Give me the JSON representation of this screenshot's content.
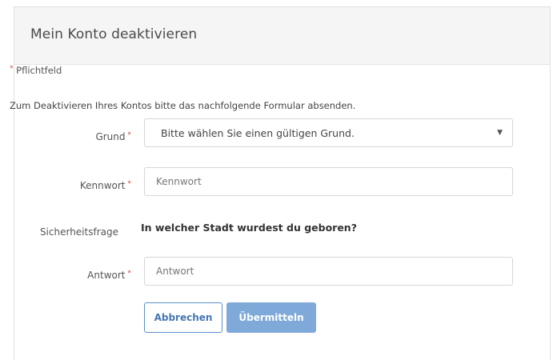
{
  "dialog": {
    "title": "Mein Konto deaktivieren",
    "required_note": "Pflichtfeld",
    "intro": "Zum Deaktivieren Ihres Kontos bitte das nachfolgende Formular absenden."
  },
  "form": {
    "reason": {
      "label": "Grund",
      "selected": "Bitte wählen Sie einen gültigen Grund."
    },
    "password": {
      "label": "Kennwort",
      "placeholder": "Kennwort"
    },
    "security_question": {
      "label": "Sicherheitsfrage",
      "question": "In welcher Stadt wurdest du geboren?"
    },
    "answer": {
      "label": "Antwort",
      "placeholder": "Antwort"
    },
    "required_marker": "*"
  },
  "buttons": {
    "cancel": "Abbrechen",
    "submit": "Übermitteln"
  },
  "colors": {
    "required": "#d0453b",
    "primary": "#7fa9d9",
    "link": "#4677b3"
  }
}
